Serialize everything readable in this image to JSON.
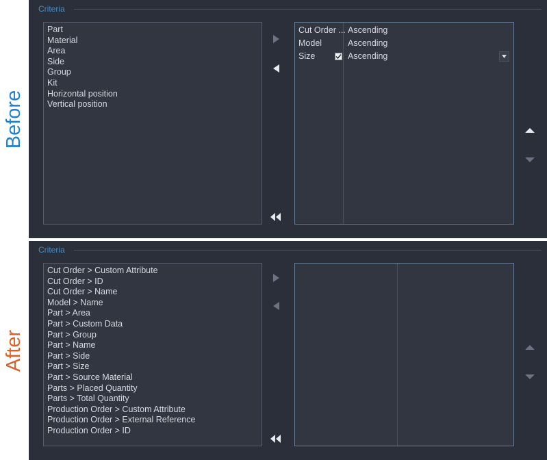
{
  "labels": {
    "before": "Before",
    "after": "After",
    "before_color": "#1e81ce",
    "after_color": "#d9622b"
  },
  "theme": {
    "panel_bg": "#2b2f3a",
    "list_bg": "#323641",
    "text": "#d6d9e0",
    "legend": "#3f8fd1",
    "border_plain": "#585e6e",
    "border_accent": "#6b7f99",
    "arrow_on": "#e8eaee",
    "arrow_off": "#6d7283"
  },
  "before": {
    "group_title": "Criteria",
    "available_list": {
      "items": [
        "Part",
        "Material",
        "Area",
        "Side",
        "Group",
        "Kit",
        "Horizontal position",
        "Vertical position"
      ]
    },
    "selected_table": {
      "rows": [
        {
          "name": "Cut Order ...",
          "direction": "Ascending",
          "checkbox": false,
          "dropdown": false
        },
        {
          "name": "Model",
          "direction": "Ascending",
          "checkbox": false,
          "dropdown": false
        },
        {
          "name": "Size",
          "direction": "Ascending",
          "checkbox": true,
          "checked": true,
          "dropdown": true
        }
      ]
    },
    "controls": {
      "add_icon": "triangle-right-icon",
      "add_enabled": false,
      "remove_icon": "triangle-left-icon",
      "remove_enabled": true,
      "remove_all_icon": "double-chevron-left-icon",
      "remove_all_enabled": true,
      "move_up_icon": "triangle-up-icon",
      "move_up_enabled": true,
      "move_down_icon": "triangle-down-icon",
      "move_down_enabled": false
    }
  },
  "after": {
    "group_title": "Criteria",
    "available_list": {
      "items": [
        "Cut Order > Custom Attribute",
        "Cut Order > ID",
        "Cut Order > Name",
        "Model > Name",
        "Part > Area",
        "Part > Custom Data",
        "Part > Group",
        "Part > Name",
        "Part > Side",
        "Part > Size",
        "Part > Source Material",
        "Parts > Placed Quantity",
        "Parts > Total Quantity",
        "Production Order > Custom Attribute",
        "Production Order > External Reference",
        "Production Order > ID"
      ]
    },
    "selected_table": {
      "rows": []
    },
    "controls": {
      "add_icon": "triangle-right-icon",
      "add_enabled": false,
      "remove_icon": "triangle-left-icon",
      "remove_enabled": false,
      "remove_all_icon": "double-chevron-left-icon",
      "remove_all_enabled": true,
      "move_up_icon": "triangle-up-icon",
      "move_up_enabled": false,
      "move_down_icon": "triangle-down-icon",
      "move_down_enabled": false
    }
  }
}
